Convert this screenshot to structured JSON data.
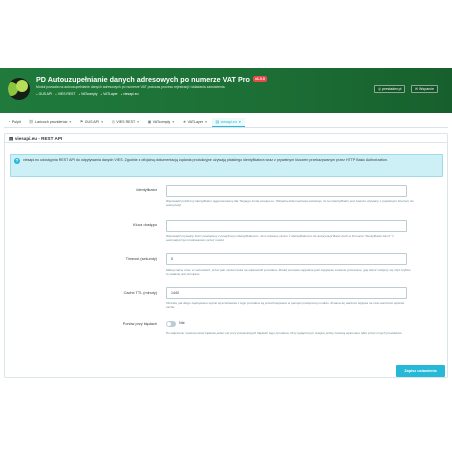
{
  "header": {
    "title": "PD Autouzupełnianie danych adresowych po numerze VAT Pro",
    "version_badge": "v1.0.0",
    "description": "Moduł pozwala na autouzupełnianie danych adresowych po numerze VAT podczas procesu rejestracji i składania zamówienia.",
    "modules": [
      "GUS API",
      "VIES REST",
      "VATcomply",
      "VATLayer",
      "viesapi.eu"
    ],
    "links": [
      {
        "label": "prestadev.pl",
        "icon": "globe-icon"
      },
      {
        "label": "Wsparcie",
        "icon": "envelope-icon"
      }
    ]
  },
  "tabs": [
    {
      "label": "Pulpit",
      "icon": "dashboard-icon",
      "chevron": false,
      "active": false
    },
    {
      "label": "Lańcuch providerów",
      "icon": "link-icon",
      "chevron": true,
      "active": false
    },
    {
      "label": "GUS API",
      "icon": "flag-icon",
      "chevron": true,
      "active": false
    },
    {
      "label": "VIES REST",
      "icon": "globe-icon",
      "chevron": true,
      "active": false
    },
    {
      "label": "VATcomply",
      "icon": "car-icon",
      "chevron": true,
      "active": false
    },
    {
      "label": "VATLayer",
      "icon": "star-icon",
      "chevron": true,
      "active": false
    },
    {
      "label": "viesapi.eu",
      "icon": "lock-icon",
      "chevron": true,
      "active": true
    }
  ],
  "panel": {
    "title": "viesapi.eu - REST API",
    "info": "viesapi.eu udostępnia REST API do odpytywania danych VIES. Zgodnie z oficjalną dokumentacją żądania produkcyjne używają płaskiego identyfikatora wraz z prywatnym kluczem przekazywanym przez HTTP Basic Authorization."
  },
  "fields": {
    "identifier": {
      "label": "Identyfikator",
      "value": "",
      "help": "Wprowadź publiczny identyfikator wygenerowany dla Twojego konta viesapi.eu. Oficjalna dokumentacja wskazuje, że ten identyfikator jest zawsze używany z prywatnym kluczem do autoryzacji."
    },
    "key": {
      "label": "Klucz dostępu",
      "value": "",
      "help": "Wprowadź prywatny klucz powiązany z powyższym identyfikatorem. Jest używany razem z identyfikatorem do autoryzacji Basic Auth w formacie \"identyfikator:klucz\" z automatycznym kodowaniem przez moduł."
    },
    "timeout": {
      "label": "Timeout (sekundy)",
      "value": "5",
      "help": "Maksymalny czas, w sekundach, przez jaki moduł czeka na odpowiedź providera. Moduł ponawia zapytanie jeśli zapytanie zostanie przerwane, gdy klient rozłączy się zbyt szybko, to zadanie jest pomijane."
    },
    "cache": {
      "label": "Cache TTL (minuty)",
      "value": "1440",
      "help": "Określa, jak długo zapisywane wyniki wyszukiwania z tego providera są przechowywane w pamięci podręcznej modułu. Zmiana tej wartości wpływa na czas ważności wpisów cache."
    },
    "retry": {
      "label": "Ponów przy błędach",
      "value": "Nie",
      "help": "Po włączeniu moduł ponowi żądanie jeden raz przy przejściowych błędach tego providera. Przy wyłączonym kolejne próby zostaną wykonane tylko przez innych providerów."
    }
  },
  "save_label": "Zapisz ustawienia"
}
